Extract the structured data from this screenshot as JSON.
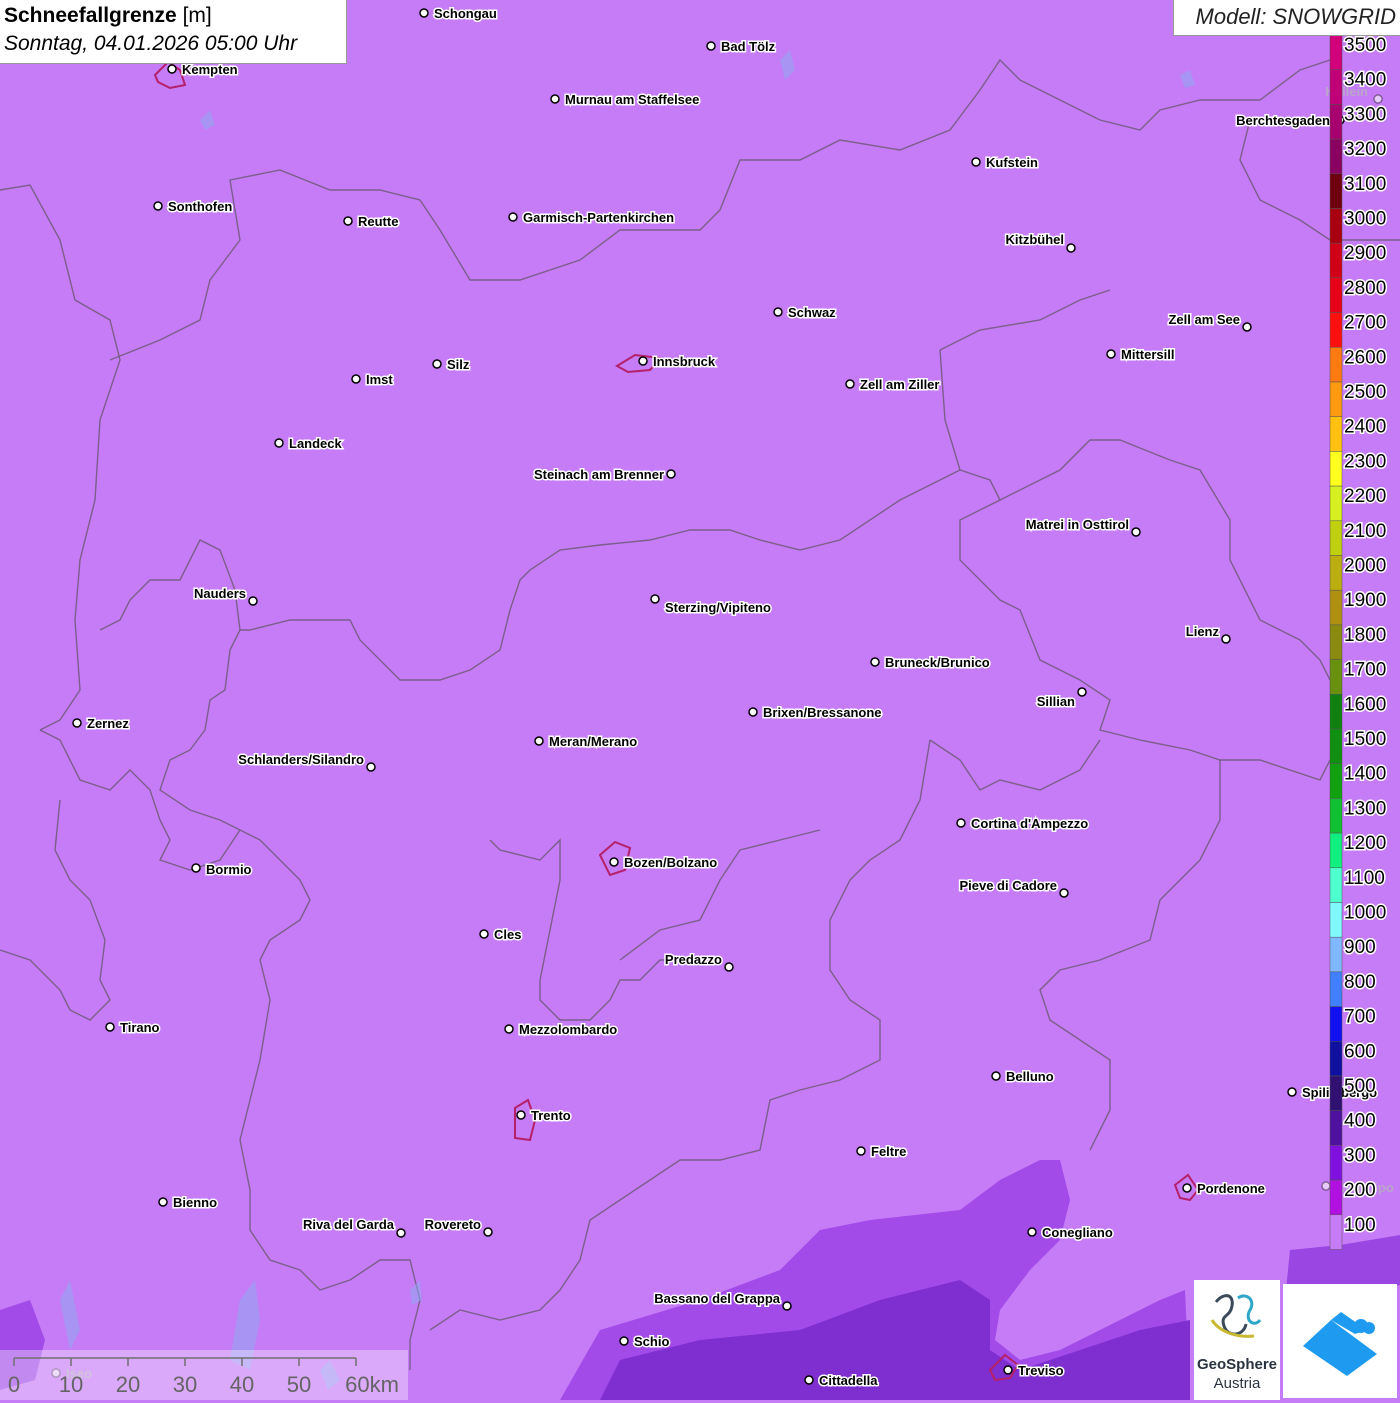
{
  "header": {
    "title_bold": "Schneefallgrenze",
    "title_unit": "[m]",
    "datetime": "Sonntag, 04.01.2026 05:00 Uhr"
  },
  "model": {
    "label": "Modell: SNOWGRID"
  },
  "legend": {
    "labels": [
      "3500",
      "3400",
      "3300",
      "3200",
      "3100",
      "3000",
      "2900",
      "2800",
      "2700",
      "2600",
      "2500",
      "2400",
      "2300",
      "2200",
      "2100",
      "2000",
      "1900",
      "1800",
      "1700",
      "1600",
      "1500",
      "1400",
      "1300",
      "1200",
      "1100",
      "1000",
      "900",
      "800",
      "700",
      "600",
      "500",
      "400",
      "300",
      "200",
      "100"
    ],
    "colors": [
      "#d1007a",
      "#c10078",
      "#a8006e",
      "#8a0060",
      "#6e0010",
      "#a80010",
      "#d00018",
      "#e60018",
      "#ff1010",
      "#ff7a10",
      "#ff9a10",
      "#ffc010",
      "#ffff20",
      "#d6f020",
      "#c0d010",
      "#bcae10",
      "#b09010",
      "#8a8a10",
      "#6a9010",
      "#108010",
      "#109010",
      "#10a010",
      "#10c030",
      "#10f080",
      "#50ffd0",
      "#80f8ff",
      "#80b8ff",
      "#4080ff",
      "#1010f0",
      "#1010a0",
      "#301070",
      "#5010a0",
      "#8010e0",
      "#b010e0",
      "#c67cf7"
    ]
  },
  "cities": [
    {
      "name": "Schongau"
    },
    {
      "name": "Bad Tölz"
    },
    {
      "name": "Kempten"
    },
    {
      "name": "Murnau am Staffelsee"
    },
    {
      "name": "Hallein"
    },
    {
      "name": "Berchtesgaden"
    },
    {
      "name": "Kufstein"
    },
    {
      "name": "Sonthofen"
    },
    {
      "name": "Reutte"
    },
    {
      "name": "Garmisch-Partenkirchen"
    },
    {
      "name": "Kitzbühel"
    },
    {
      "name": "Schwaz"
    },
    {
      "name": "Zell am See"
    },
    {
      "name": "Mittersill"
    },
    {
      "name": "Innsbruck"
    },
    {
      "name": "Imst"
    },
    {
      "name": "Silz"
    },
    {
      "name": "Zell am Ziller"
    },
    {
      "name": "Landeck"
    },
    {
      "name": "Steinach am Brenner"
    },
    {
      "name": "Matrei in Osttirol"
    },
    {
      "name": "Nauders"
    },
    {
      "name": "Sterzing/Vipiteno"
    },
    {
      "name": "Lienz"
    },
    {
      "name": "Bruneck/Brunico"
    },
    {
      "name": "Sillian"
    },
    {
      "name": "Zernez"
    },
    {
      "name": "Brixen/Bressanone"
    },
    {
      "name": "Meran/Merano"
    },
    {
      "name": "Schlanders/Silandro"
    },
    {
      "name": "Cortina d'Ampezzo"
    },
    {
      "name": "Bozen/Bolzano"
    },
    {
      "name": "Bormio"
    },
    {
      "name": "Pieve di Cadore"
    },
    {
      "name": "Cles"
    },
    {
      "name": "Predazzo"
    },
    {
      "name": "Tirano"
    },
    {
      "name": "Mezzolombardo"
    },
    {
      "name": "Belluno"
    },
    {
      "name": "Spilimbergo"
    },
    {
      "name": "Trento"
    },
    {
      "name": "Feltre"
    },
    {
      "name": "Pordenone"
    },
    {
      "name": "Codroipo"
    },
    {
      "name": "Bienno"
    },
    {
      "name": "Riva del Garda"
    },
    {
      "name": "Rovereto"
    },
    {
      "name": "Conegliano"
    },
    {
      "name": "Bassano del Grappa"
    },
    {
      "name": "Schio"
    },
    {
      "name": "Treviso"
    },
    {
      "name": "Cittadella"
    },
    {
      "name": "Iseo"
    }
  ],
  "scalebar": {
    "ticks": [
      "0",
      "10",
      "20",
      "30",
      "40",
      "50",
      "60km"
    ]
  },
  "logos": {
    "geosphere_line1": "GeoSphere",
    "geosphere_line2": "Austria"
  },
  "colors": {
    "background": "#c67cf7",
    "low_snowline": "#a24be8",
    "lowest_snowline": "#7f2fd0",
    "borders": "#6d5a78"
  }
}
